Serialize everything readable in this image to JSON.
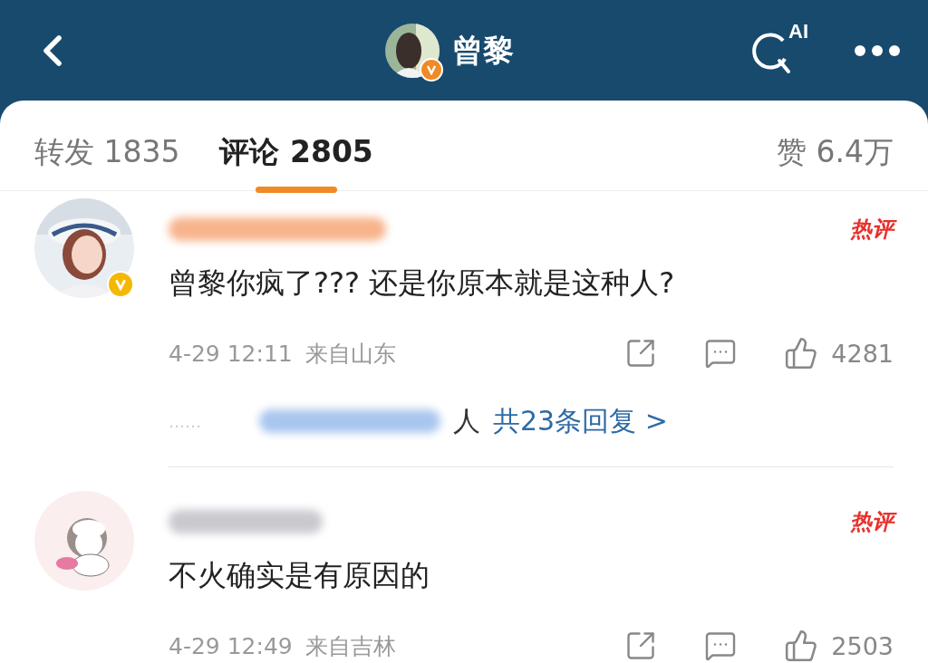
{
  "header": {
    "title": "曾黎",
    "search_label": "AI"
  },
  "tabs": [
    {
      "label": "转发 1835",
      "selected": false
    },
    {
      "label": "评论 2805",
      "selected": true
    },
    {
      "label": "赞 6.4万",
      "selected": false
    }
  ],
  "comments": [
    {
      "verified": true,
      "badge": "热评",
      "text": "曾黎你疯了??? 还是你原本就是这种人?",
      "time": "4-29 12:11",
      "location": "来自山东",
      "likes": "4281",
      "replies": {
        "dots": "……",
        "tail": "人",
        "link": "共23条回复 >"
      }
    },
    {
      "verified": false,
      "badge": "热评",
      "text": "不火确实是有原因的",
      "time": "4-29 12:49",
      "location": "来自吉林",
      "likes": "2503"
    }
  ]
}
